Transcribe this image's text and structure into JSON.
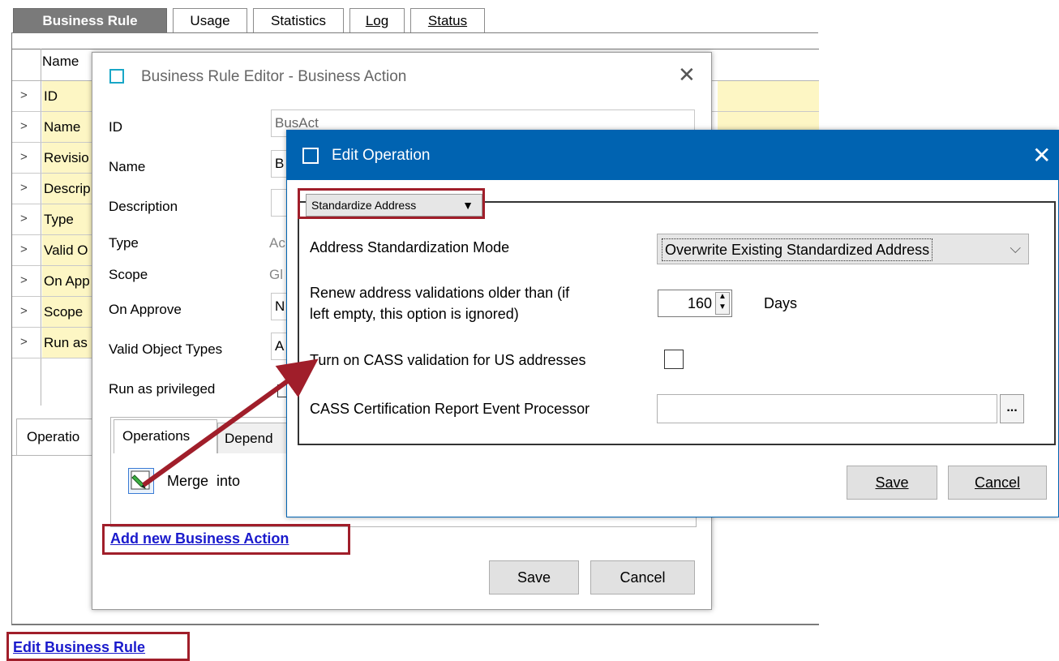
{
  "top_tabs": [
    {
      "label": "Business Rule",
      "active": true
    },
    {
      "label": "Usage",
      "active": false
    },
    {
      "label": "Statistics",
      "active": false
    },
    {
      "label": "Log",
      "active": false
    },
    {
      "label": "Status",
      "active": false
    }
  ],
  "bg_table": {
    "header": "Name",
    "rows": [
      "ID",
      "Name",
      "Revisio",
      "Descrip",
      "Type",
      "Valid O",
      "On App",
      "Scope",
      "Run as"
    ]
  },
  "bg_lower_tab": "Operatio",
  "edit_business_rule_link": "Edit Business Rule",
  "bre_dialog": {
    "title": "Business Rule Editor - Business Action",
    "fields": [
      {
        "label": "ID",
        "value": "BusAct"
      },
      {
        "label": "Name",
        "value": "B"
      },
      {
        "label": "Description",
        "value": ""
      },
      {
        "label": "Type",
        "value": "Ac"
      },
      {
        "label": "Scope",
        "value": "Gl"
      },
      {
        "label": "On Approve",
        "value": "N"
      },
      {
        "label": "Valid Object Types",
        "value": "A"
      },
      {
        "label": "Run as privileged",
        "value": ""
      }
    ],
    "tabs": [
      "Operations",
      "Depend"
    ],
    "operation_item": "Merge  into",
    "add_link": "Add new Business Action",
    "save": "Save",
    "cancel": "Cancel"
  },
  "edit_op_dialog": {
    "title": "Edit Operation",
    "operation_select": "Standardize Address",
    "mode_label": "Address Standardization Mode",
    "mode_value": "Overwrite Existing Standardized Address",
    "renew_label_line1": "Renew address validations older than (if",
    "renew_label_line2": "left empty, this option is ignored)",
    "renew_value": "160",
    "renew_unit": "Days",
    "cass_label": "Turn on CASS validation for US addresses",
    "cass_checked": false,
    "processor_label": "CASS Certification Report Event Processor",
    "processor_value": "",
    "browse_label": "...",
    "save": "Save",
    "cancel": "Cancel"
  },
  "colors": {
    "title_bar": "#0063b1",
    "highlight_box": "#a01e2a",
    "link": "#1a1acc",
    "row_highlight": "#fdf6c4"
  }
}
